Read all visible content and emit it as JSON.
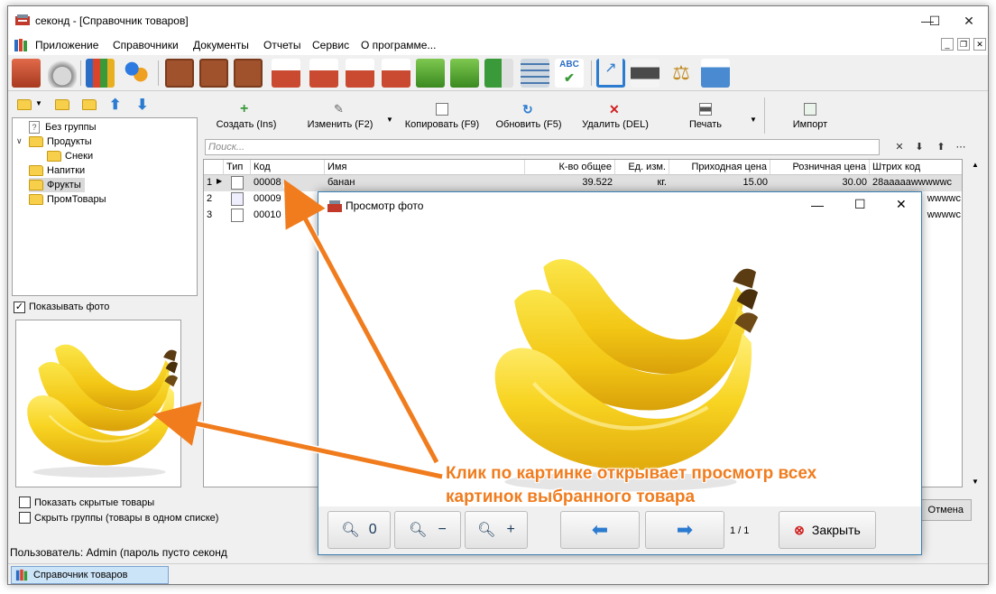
{
  "window": {
    "title": "секонд - [Справочник товаров]"
  },
  "menu": [
    "Приложение",
    "Справочники",
    "Документы",
    "Отчеты",
    "Сервис",
    "О программе..."
  ],
  "actions": {
    "create": "Создать (Ins)",
    "edit": "Изменить (F2)",
    "copy": "Копировать (F9)",
    "refresh": "Обновить (F5)",
    "delete": "Удалить (DEL)",
    "print": "Печать",
    "import": "Импорт"
  },
  "search": {
    "placeholder": "Поиск..."
  },
  "tree": [
    "Без группы",
    "Продукты",
    "Снеки",
    "Напитки",
    "Фрукты",
    "ПромТовары"
  ],
  "show_photo_label": "Показывать фото",
  "table": {
    "columns": [
      "Тип",
      "Код",
      "Имя",
      "К-во общее",
      "Ед. изм.",
      "Приходная цена",
      "Розничная цена",
      "Штрих код"
    ],
    "rows": [
      {
        "num": "1",
        "code": "00008",
        "name": "банан",
        "qty": "39.522",
        "unit": "кг.",
        "in_price": "15.00",
        "retail": "30.00",
        "barcode": "28aaaaawwwwwc"
      },
      {
        "num": "2",
        "code": "00009",
        "barcode": "wwwwc"
      },
      {
        "num": "3",
        "code": "00010",
        "barcode": "wwwwc"
      }
    ]
  },
  "bottom": {
    "show_hidden": "Показать скрытые товары",
    "hide_groups": "Скрыть группы (товары в одном списке)",
    "cancel": "Отмена"
  },
  "status": "Пользователь: Admin (пароль пусто  секонд",
  "task": "Справочник товаров",
  "dialog": {
    "title": "Просмотр фото",
    "zoom_reset": "0",
    "zoom_out": "−",
    "zoom_in": "+",
    "page": "1 / 1",
    "close": "Закрыть"
  },
  "callout": {
    "line1": "Клик по картинке открывает просмотр всех",
    "line2": "картинок выбранного товара"
  },
  "colors": {
    "accent": "#f07c1e",
    "selection": "#cce4f7",
    "banana": "#f7d21b"
  }
}
